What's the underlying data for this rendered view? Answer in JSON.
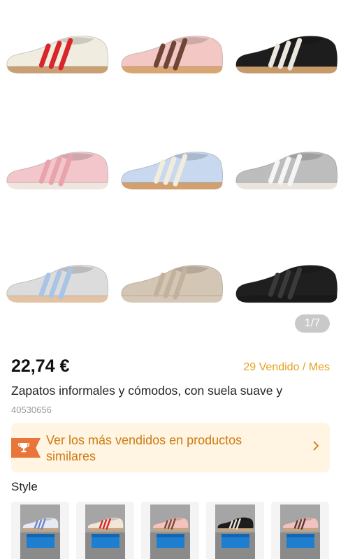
{
  "gallery": {
    "counter": "1/7",
    "shoes": [
      {
        "name": "cream-red",
        "base": "#f1ece0",
        "stripe": "#d9262b",
        "sole": "#c9a074"
      },
      {
        "name": "pink-brown",
        "base": "#f3c8c4",
        "stripe": "#6e4536",
        "sole": "#d9a671"
      },
      {
        "name": "black-white",
        "base": "#1d1d1d",
        "stripe": "#ece7dc",
        "sole": "#c79a6a"
      },
      {
        "name": "pink-pink",
        "base": "#f2c6cb",
        "stripe": "#e9a3ab",
        "sole": "#efe6e0"
      },
      {
        "name": "blue-cream",
        "base": "#c8d9ef",
        "stripe": "#f1ecdd",
        "sole": "#d29f6f"
      },
      {
        "name": "silver-white",
        "base": "#bdbdbd",
        "stripe": "#f5f5f5",
        "sole": "#e9e4de"
      },
      {
        "name": "grey-blue",
        "base": "#dcdcdc",
        "stripe": "#a9c4e4",
        "sole": "#e4c3a5"
      },
      {
        "name": "beige-beige",
        "base": "#d4c6b4",
        "stripe": "#c2b29d",
        "sole": "#d6c8b6"
      },
      {
        "name": "black-black",
        "base": "#1f1f1f",
        "stripe": "#3a3a3a",
        "sole": "#1a1a1a"
      }
    ]
  },
  "product": {
    "price": "22,74 €",
    "sold": "29 Vendido / Mes",
    "title": "Zapatos informales y cómodos, con suela suave y",
    "sku": "40530656"
  },
  "banner": {
    "text": "Ver los más vendidos en productos similares",
    "icon": "trophy-icon",
    "arrow": "chevron-right-icon",
    "accent": "#e8753a"
  },
  "style": {
    "label": "Style",
    "thumbs": [
      {
        "name": "white-blue",
        "base": "#e8eaf2",
        "stripe": "#6a86c8",
        "box": "#1e7fd1"
      },
      {
        "name": "cream-red",
        "base": "#f1e6d8",
        "stripe": "#d9262b",
        "box": "#1e7fd1"
      },
      {
        "name": "pink-brown",
        "base": "#f2c4bc",
        "stripe": "#7a4a3a",
        "box": "#1e7fd1"
      },
      {
        "name": "black-white",
        "base": "#1d1d1d",
        "stripe": "#ece7dc",
        "box": "#1e7fd1"
      },
      {
        "name": "pink-dark",
        "base": "#f0c2c0",
        "stripe": "#5a3a30",
        "box": "#1e7fd1"
      }
    ]
  }
}
